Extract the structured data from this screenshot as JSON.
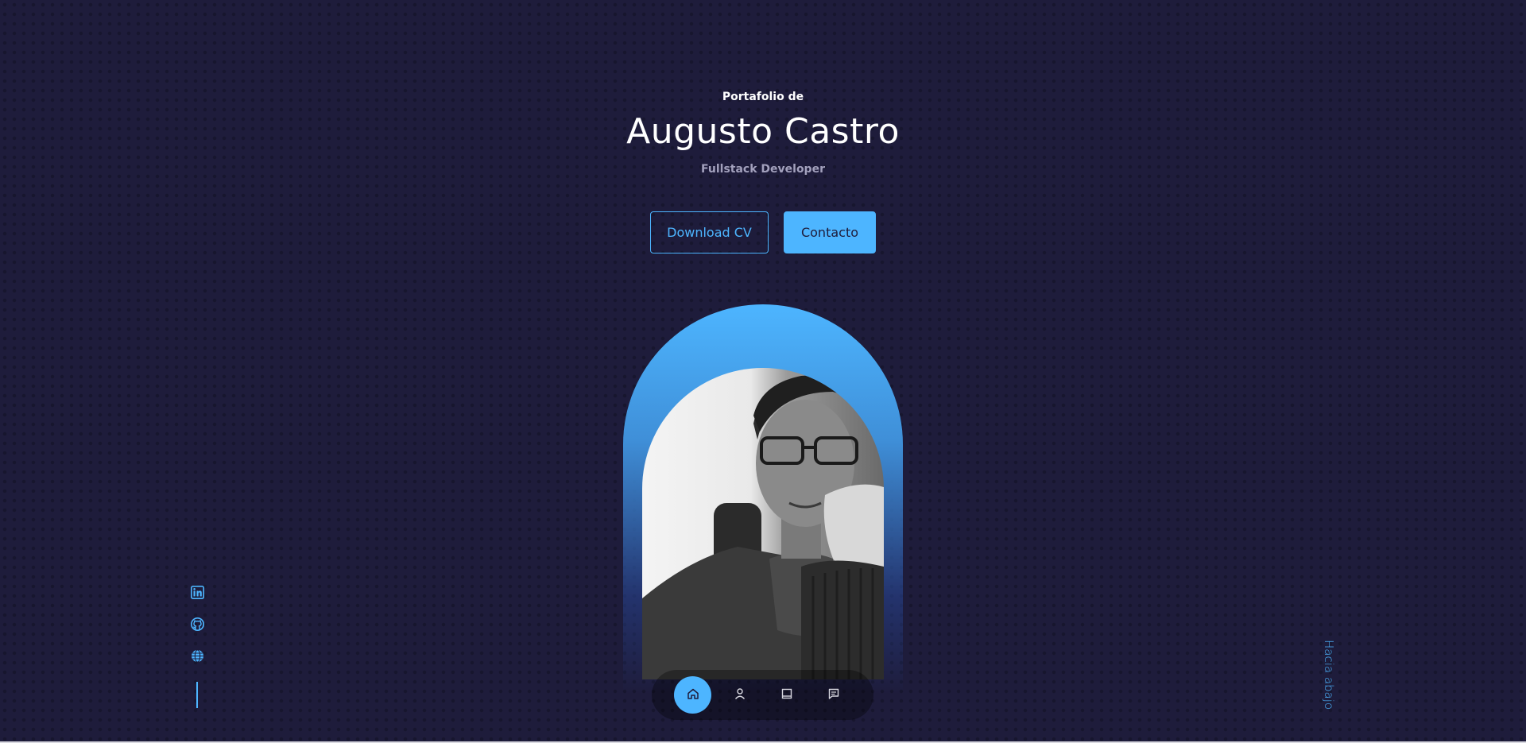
{
  "header": {
    "eyebrow": "Portafolio de",
    "name": "Augusto Castro",
    "role": "Fullstack Developer"
  },
  "actions": {
    "download_cv_label": "Download CV",
    "contact_label": "Contacto"
  },
  "profile": {
    "photo_icon": "profile-photo"
  },
  "nav": {
    "items": [
      {
        "icon": "home-icon",
        "active": true
      },
      {
        "icon": "user-icon",
        "active": false
      },
      {
        "icon": "book-icon",
        "active": false
      },
      {
        "icon": "message-icon",
        "active": false
      }
    ]
  },
  "socials": [
    {
      "icon": "linkedin-icon"
    },
    {
      "icon": "github-icon"
    },
    {
      "icon": "globe-icon"
    }
  ],
  "scroll_down_label": "Hacia abajo",
  "colors": {
    "background": "#1e1c3b",
    "accent": "#4db5ff",
    "muted_text": "#a3a1bd"
  }
}
